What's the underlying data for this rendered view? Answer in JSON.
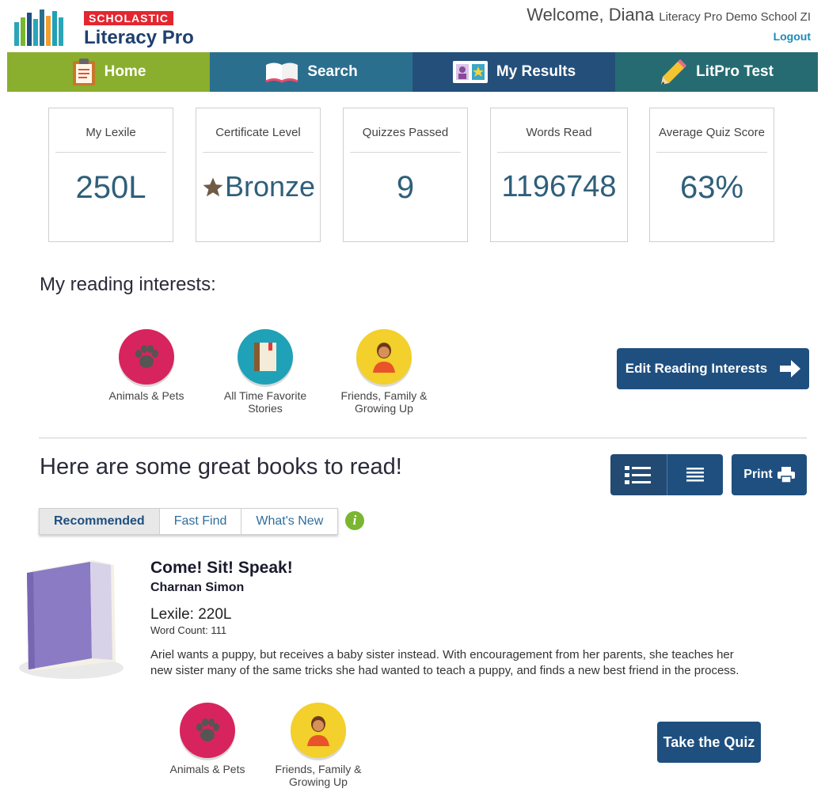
{
  "brand": {
    "publisher": "SCHOLASTIC",
    "product": "Literacy Pro"
  },
  "user": {
    "welcome": "Welcome, Diana",
    "school": "Literacy Pro Demo School ZI",
    "logout": "Logout"
  },
  "nav": [
    {
      "label": "Home",
      "icon": "clipboard-icon",
      "color": "#8aae2e"
    },
    {
      "label": "Search",
      "icon": "open-book-icon",
      "color": "#2b6f8e"
    },
    {
      "label": "My Results",
      "icon": "results-card-icon",
      "color": "#244f7a"
    },
    {
      "label": "LitPro Test",
      "icon": "pencil-icon",
      "color": "#266b72"
    }
  ],
  "stats": [
    {
      "label": "My Lexile",
      "value": "250L"
    },
    {
      "label": "Certificate Level",
      "value": "Bronze",
      "icon": "star-icon"
    },
    {
      "label": "Quizzes Passed",
      "value": "9"
    },
    {
      "label": "Words Read",
      "value": "1196748"
    },
    {
      "label": "Average Quiz Score",
      "value": "63%"
    }
  ],
  "interests": {
    "title": "My reading interests:",
    "items": [
      {
        "label": "Animals & Pets",
        "icon": "paw-icon"
      },
      {
        "label": "All Time Favorite Stories",
        "icon": "book-icon"
      },
      {
        "label": "Friends, Family & Growing Up",
        "icon": "person-icon"
      }
    ],
    "edit_button": "Edit Reading Interests"
  },
  "books": {
    "title": "Here are some great books to read!",
    "print_label": "Print",
    "tabs": [
      "Recommended",
      "Fast Find",
      "What's New"
    ],
    "info_label": "i",
    "book": {
      "title": "Come! Sit! Speak!",
      "author": "Charnan Simon",
      "lexile": "Lexile: 220L",
      "word_count": "Word Count: 111",
      "description": "Ariel wants a puppy, but receives a baby sister instead. With encouragement from her parents, she teaches her new sister many of the same tricks she had wanted to teach a puppy, and finds a new best friend in the process.",
      "tags": [
        {
          "label": "Animals & Pets",
          "icon": "paw-icon"
        },
        {
          "label": "Friends, Family & Growing Up",
          "icon": "person-icon"
        }
      ],
      "quiz_button": "Take the Quiz"
    }
  }
}
